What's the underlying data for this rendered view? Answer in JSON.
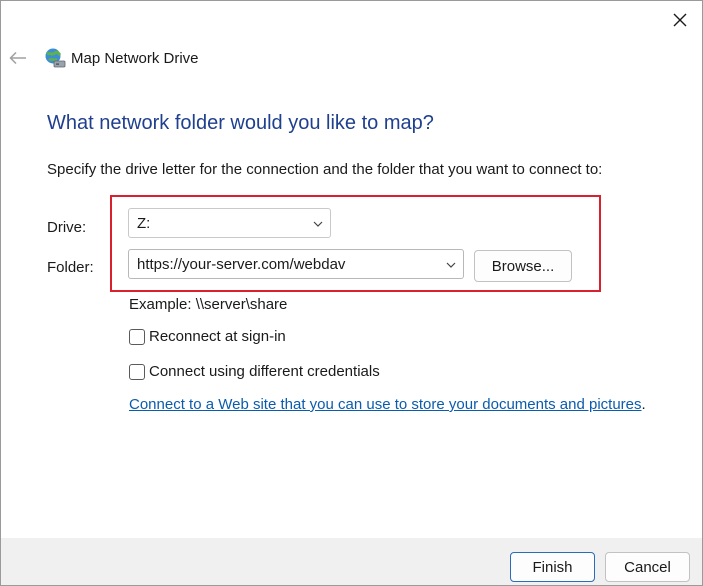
{
  "window": {
    "title": "Map Network Drive"
  },
  "content": {
    "heading": "What network folder would you like to map?",
    "instruction": "Specify the drive letter for the connection and the folder that you want to connect to:",
    "drive_label": "Drive:",
    "drive_value": "Z:",
    "folder_label": "Folder:",
    "folder_value": "https://your-server.com/webdav",
    "browse_label": "Browse...",
    "example": "Example: \\\\server\\share",
    "reconnect_label": "Reconnect at sign-in",
    "reconnect_checked": false,
    "credentials_label": "Connect using different credentials",
    "credentials_checked": false,
    "link_text": "Connect to a Web site that you can use to store your documents and pictures",
    "link_suffix": "."
  },
  "footer": {
    "finish_label": "Finish",
    "cancel_label": "Cancel"
  },
  "colors": {
    "heading": "#1f3f8f",
    "link": "#0b5cad",
    "highlight": "#d9202e",
    "primary_border": "#2b6cb8"
  },
  "icons": {
    "close": "close-icon",
    "back": "back-arrow-icon",
    "title": "network-drive-icon",
    "chevron": "chevron-down-icon"
  }
}
